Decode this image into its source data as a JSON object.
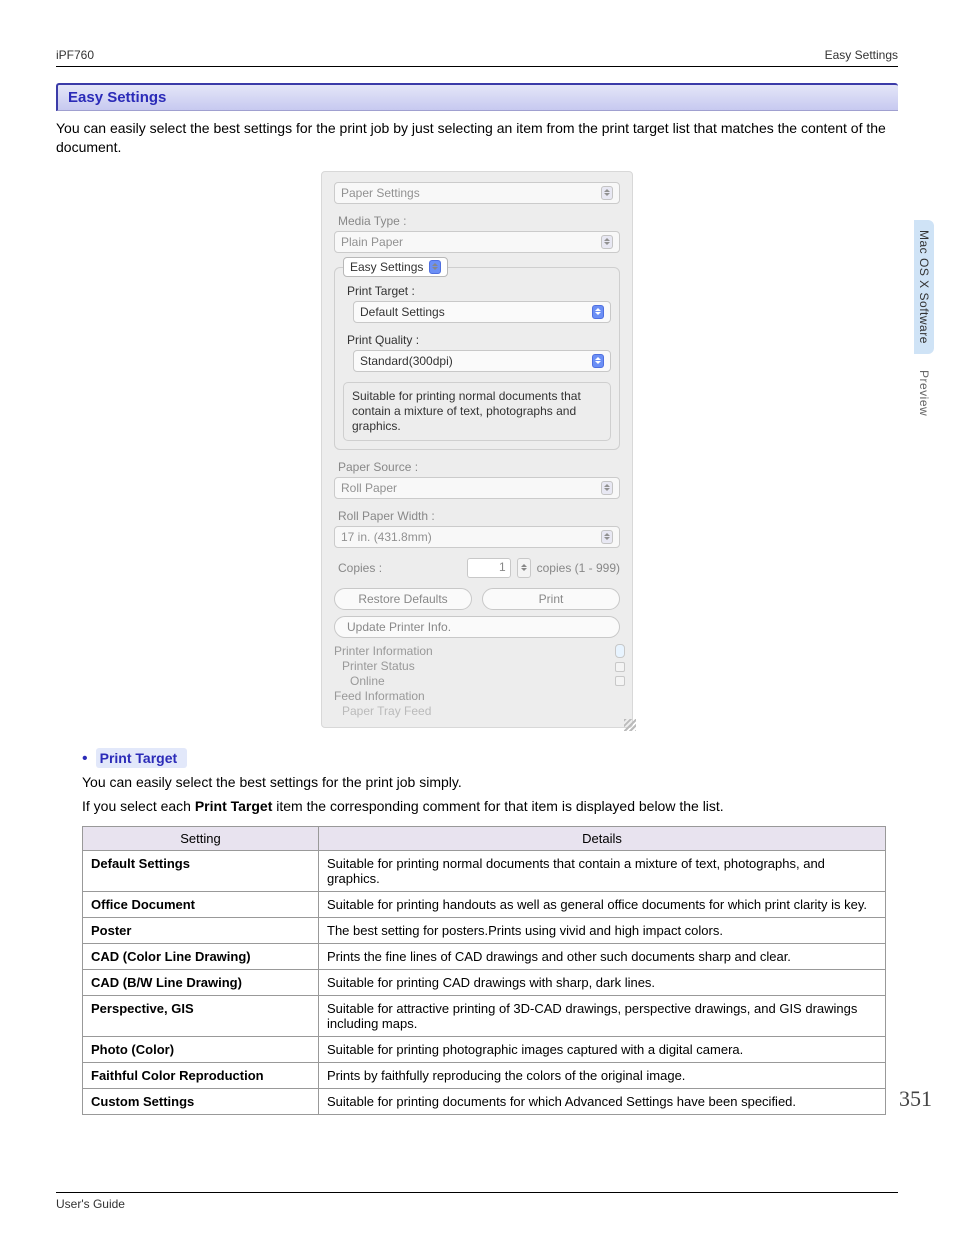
{
  "header": {
    "left": "iPF760",
    "right": "Easy Settings"
  },
  "section_title": "Easy Settings",
  "intro": "You can easily select the best settings for the print job by just selecting an item from the print target list that matches the content of the document.",
  "dialog": {
    "top_select": "Paper Settings",
    "media_type_label": "Media Type :",
    "media_type_value": "Plain Paper",
    "easy_group_title": "Easy Settings",
    "print_target_label": "Print Target :",
    "print_target_value": "Default Settings",
    "print_quality_label": "Print Quality :",
    "print_quality_value": "Standard(300dpi)",
    "description": "Suitable for printing normal documents that contain a mixture of text, photographs and graphics.",
    "paper_source_label": "Paper Source :",
    "paper_source_value": "Roll Paper",
    "roll_width_label": "Roll Paper Width :",
    "roll_width_value": "17 in. (431.8mm)",
    "copies_label": "Copies :",
    "copies_value": "1",
    "copies_range": "copies (1 - 999)",
    "restore_btn": "Restore Defaults",
    "print_btn": "Print",
    "update_btn": "Update Printer Info.",
    "info1": "Printer Information",
    "info2": "Printer Status",
    "info3": "Online",
    "info4": "Feed Information",
    "info5": "Paper Tray Feed"
  },
  "side_tabs": {
    "t1": "Mac OS X Software",
    "t2": "Preview"
  },
  "sub": {
    "title": "Print Target",
    "line1": "You can easily select the best settings for the print job simply.",
    "line2a": "If you select each ",
    "line2b": "Print Target",
    "line2c": " item the corresponding comment for that item is displayed below the list."
  },
  "table": {
    "headers": {
      "setting": "Setting",
      "details": "Details"
    },
    "rows": [
      {
        "setting": "Default Settings",
        "details": "Suitable for printing normal documents that contain a mixture of text, photographs, and graphics."
      },
      {
        "setting": "Office Document",
        "details": "Suitable for printing handouts as well as general office documents for which print clarity is key."
      },
      {
        "setting": "Poster",
        "details": "The best setting for posters.Prints using vivid and high impact colors."
      },
      {
        "setting": "CAD (Color Line Drawing)",
        "details": "Prints the fine lines of CAD drawings and other such documents sharp and clear."
      },
      {
        "setting": "CAD (B/W Line Drawing)",
        "details": "Suitable for printing CAD drawings with sharp, dark lines."
      },
      {
        "setting": "Perspective, GIS",
        "details": "Suitable for attractive printing of 3D-CAD drawings, perspective drawings, and GIS drawings including maps."
      },
      {
        "setting": "Photo (Color)",
        "details": "Suitable for printing photographic images captured with a digital camera."
      },
      {
        "setting": "Faithful Color Reproduction",
        "details": "Prints by faithfully reproducing the colors of the original image."
      },
      {
        "setting": "Custom Settings",
        "details": "Suitable for printing documents for which Advanced Settings have been specified."
      }
    ]
  },
  "page_number": "351",
  "footer": "User's Guide"
}
